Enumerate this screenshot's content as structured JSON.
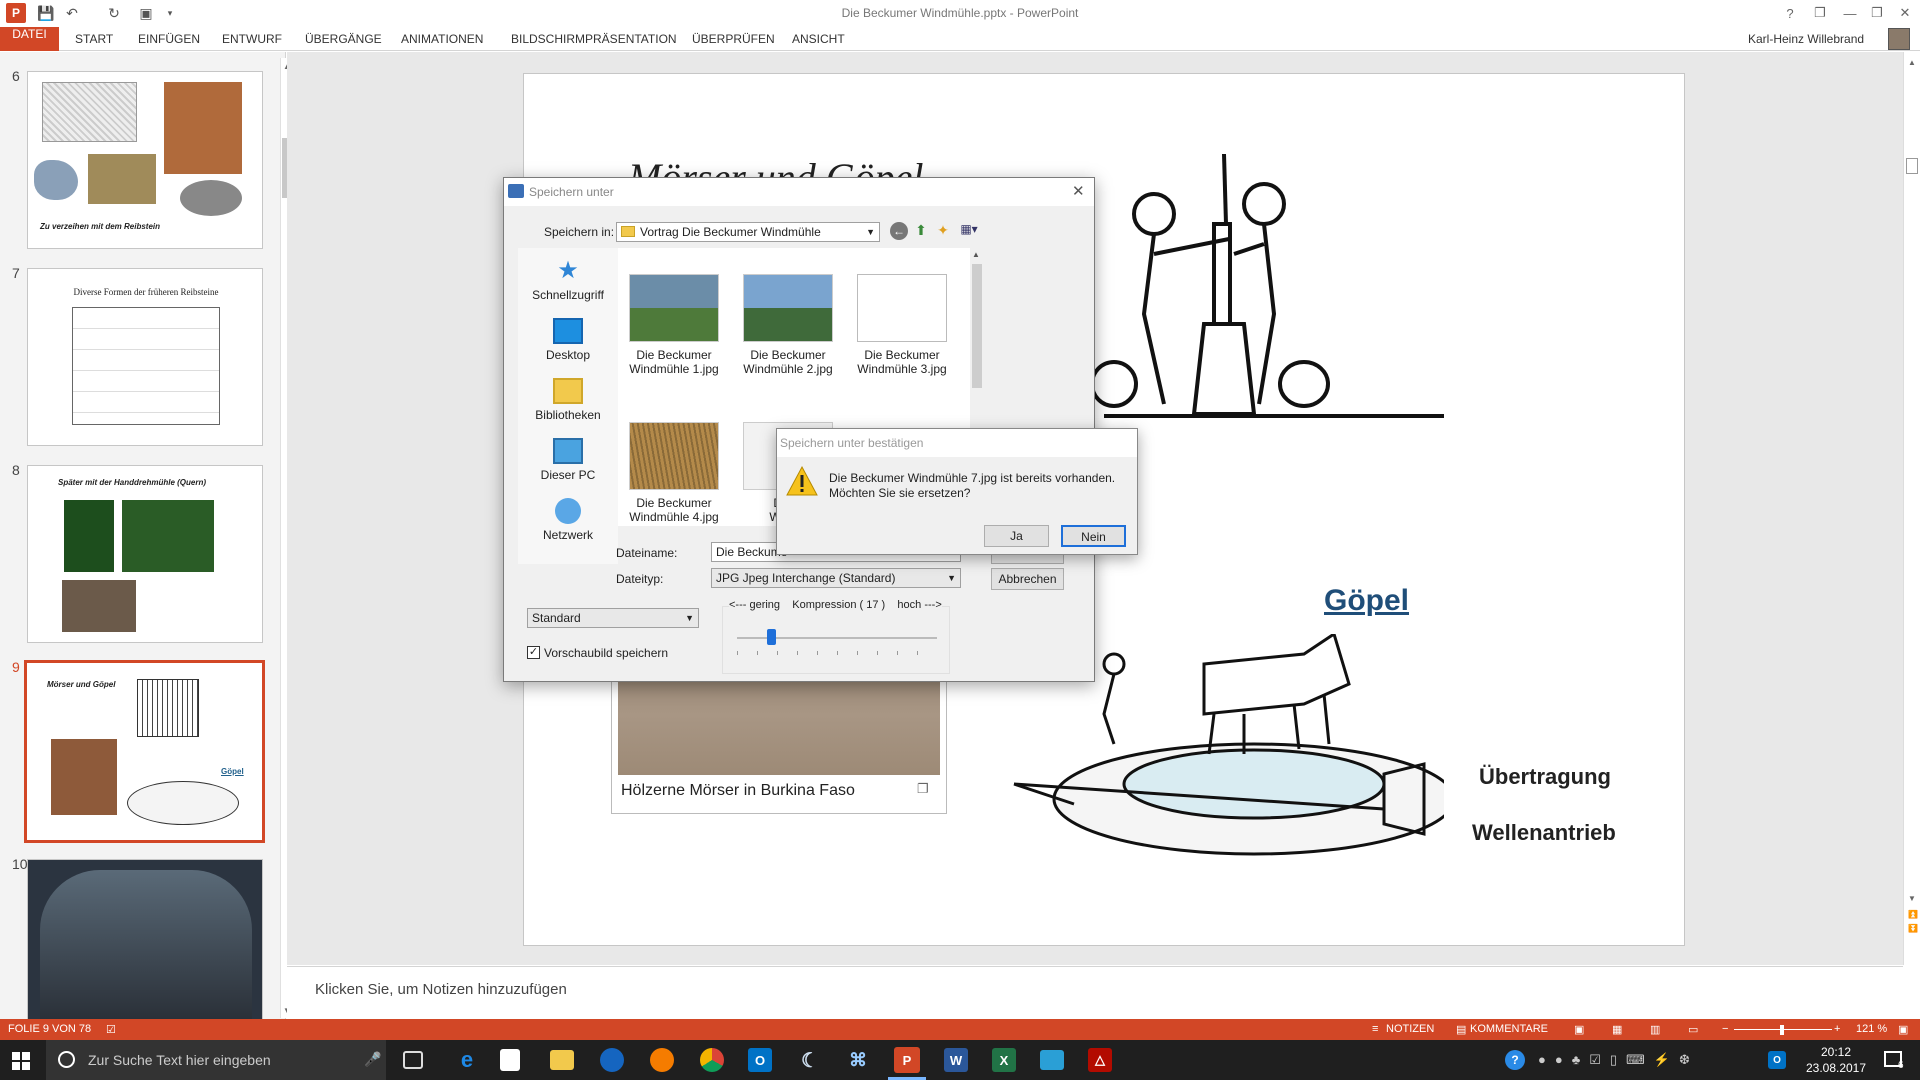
{
  "window": {
    "title": "Die Beckumer Windmühle.pptx - PowerPoint",
    "user": "Karl-Heinz Willebrand"
  },
  "tabs": [
    "DATEI",
    "START",
    "EINFÜGEN",
    "ENTWURF",
    "ÜBERGÄNGE",
    "ANIMATIONEN",
    "BILDSCHIRMPRÄSENTATION",
    "ÜBERPRÜFEN",
    "ANSICHT"
  ],
  "thumbs": {
    "s6": {
      "num": "6",
      "caption": "Zu verzeihen mit dem Reibstein"
    },
    "s7": {
      "num": "7",
      "caption": "Diverse Formen der früheren Reibsteine"
    },
    "s8": {
      "num": "8",
      "caption": "Später mit der Handdrehmühle (Quern)"
    },
    "s9": {
      "num": "9",
      "caption": "Mörser und Göpel",
      "label": "Göpel"
    },
    "s10": {
      "num": "10"
    }
  },
  "slide": {
    "title": "Mörser und Göpel",
    "goepel": "Göpel",
    "uebertragung": "Übertragung",
    "wellenantrieb": "Wellenantrieb",
    "photo_caption": "Hölzerne Mörser in Burkina Faso"
  },
  "notes": {
    "placeholder": "Klicken Sie, um Notizen hinzuzufügen"
  },
  "status": {
    "slide": "FOLIE 9 VON 78",
    "notizen": "NOTIZEN",
    "kommentare": "KOMMENTARE",
    "zoom": "121 %"
  },
  "dialog": {
    "title": "Speichern unter",
    "save_in_label": "Speichern in:",
    "save_in_value": "Vortrag Die Beckumer Windmühle",
    "places": [
      "Schnellzugriff",
      "Desktop",
      "Bibliotheken",
      "Dieser PC",
      "Netzwerk"
    ],
    "files": [
      {
        "l1": "Die Beckumer",
        "l2": "Windmühle 1.jpg"
      },
      {
        "l1": "Die Beckumer",
        "l2": "Windmühle 2.jpg"
      },
      {
        "l1": "Die Beckumer",
        "l2": "Windmühle 3.jpg"
      },
      {
        "l1": "Die Beckumer",
        "l2": "Windmühle 4.jpg"
      },
      {
        "l1": "Die B",
        "l2": "Windm"
      }
    ],
    "filename_label": "Dateiname:",
    "filename_value": "Die Beckume",
    "filetype_label": "Dateityp:",
    "filetype_value": "JPG  Jpeg Interchange (Standard)",
    "cancel": "Abbrechen",
    "standard": "Standard",
    "preview": "Vorschaubild speichern",
    "compression": "<--- gering    Kompression ( 17 )    hoch --->",
    "compression_value": 17
  },
  "confirm": {
    "title": "Speichern unter bestätigen",
    "line1": "Die Beckumer Windmühle 7.jpg ist bereits vorhanden.",
    "line2": "Möchten Sie sie ersetzen?",
    "yes": "Ja",
    "no": "Nein"
  },
  "taskbar": {
    "search": "Zur Suche Text hier eingeben",
    "time": "20:12",
    "date": "23.08.2017",
    "notif_count": "6"
  }
}
